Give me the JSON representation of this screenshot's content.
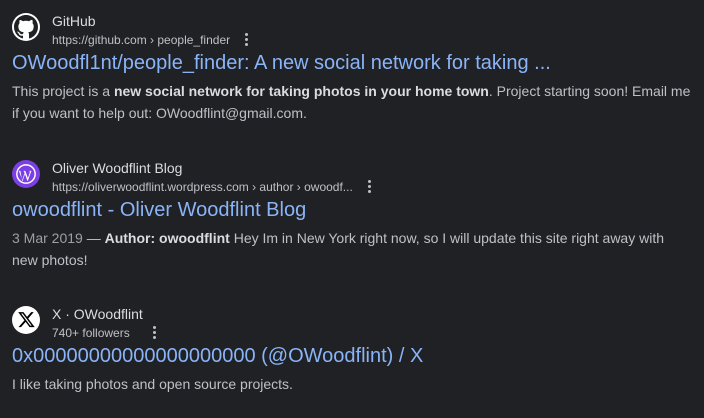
{
  "results": [
    {
      "site_name": "GitHub",
      "url_text": "https://github.com › people_finder",
      "title": "OWoodfl1nt/people_finder: A new social network for taking ...",
      "snippet": {
        "pre": "This project is a ",
        "bold": "new social network for taking photos in your home town",
        "post": ". Project starting soon! Email me if you want to help out: OWoodflint@gmail.com."
      },
      "favicon": "github-icon",
      "colors": {
        "favicon_bg": "#ffffff"
      }
    },
    {
      "site_name": "Oliver Woodflint Blog",
      "url_text": "https://oliverwoodflint.wordpress.com › author › owoodf...",
      "title": "owoodflint - Oliver Woodflint Blog",
      "snippet": {
        "date": "3 Mar 2019",
        "dash": " — ",
        "bold1": "Author:",
        "space": " ",
        "bold2": "owoodflint",
        "post": " Hey Im in New York right now, so I will update this site right away with new photos!"
      },
      "favicon": "wordpress-icon",
      "colors": {
        "favicon_bg": "#7b3fe4"
      }
    },
    {
      "site_name": "X · OWoodflint",
      "url_text": "740+ followers",
      "title": "0x00000000000000000000 (@OWoodflint) / X",
      "snippet": {
        "text": "I like taking photos and open source projects."
      },
      "favicon": "x-logo-icon",
      "colors": {
        "favicon_bg": "#ffffff"
      }
    }
  ],
  "colors": {
    "background": "#202124",
    "link": "#8ab4f8",
    "text": "#bdc1c6"
  }
}
